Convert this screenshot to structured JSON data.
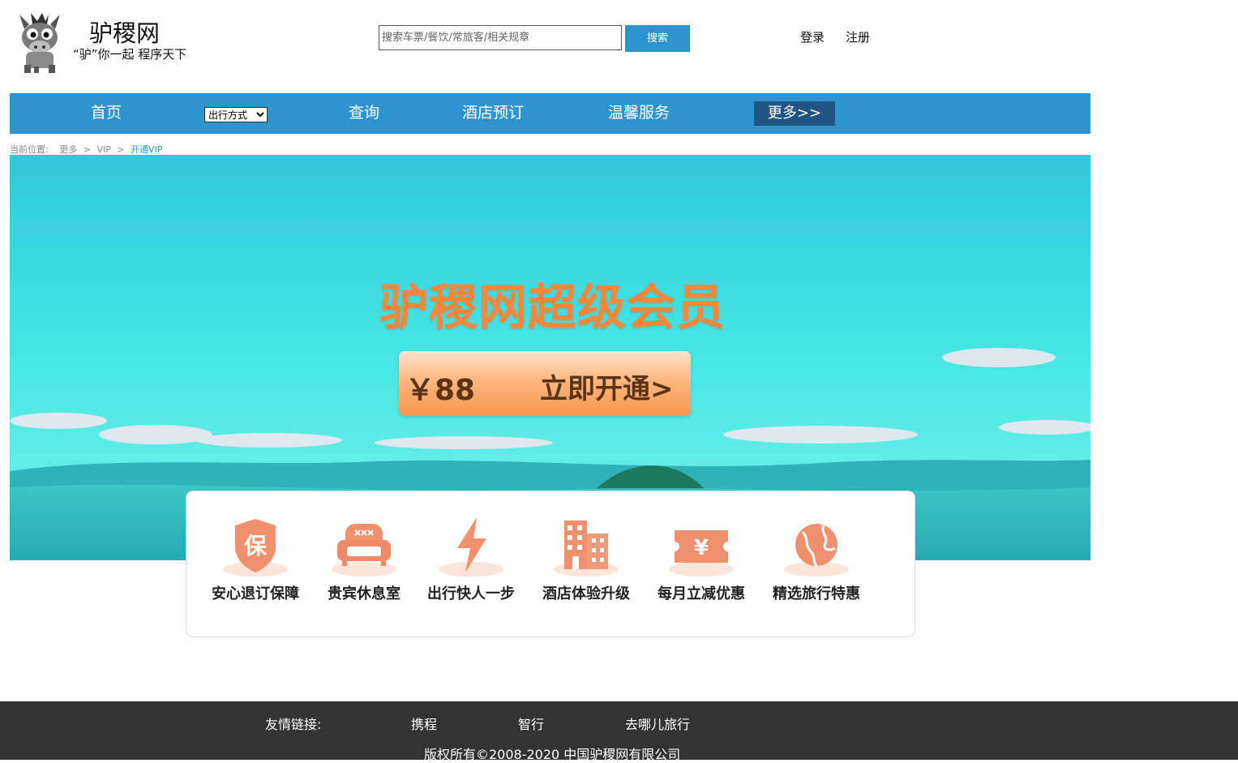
{
  "header": {
    "site_name": "驴稷网",
    "slogan": "“驴”你一起 程序天下",
    "search_placeholder": "搜索车票/餐饮/常旅客/相关规章",
    "search_button": "搜索",
    "login": "登录",
    "register": "注册"
  },
  "nav": {
    "items": [
      "首页",
      "查询",
      "酒店预订",
      "温馨服务"
    ],
    "select_value": "出行方式",
    "more": "更多>>"
  },
  "breadcrumb": {
    "label": "当前位置:",
    "path": [
      "更多",
      "VIP"
    ],
    "current": "开通VIP",
    "sep": ">"
  },
  "banner": {
    "title": "驴稷网超级会员",
    "price": "￥88",
    "cta": "立即开通>"
  },
  "benefits": [
    {
      "label": "安心退订保障",
      "icon": "shield-icon",
      "icon_text": "保"
    },
    {
      "label": "贵宾休息室",
      "icon": "sofa-icon"
    },
    {
      "label": "出行快人一步",
      "icon": "lightning-icon"
    },
    {
      "label": "酒店体验升级",
      "icon": "building-icon"
    },
    {
      "label": "每月立减优惠",
      "icon": "coupon-icon",
      "icon_text": "¥"
    },
    {
      "label": "精选旅行特惠",
      "icon": "globe-icon"
    }
  ],
  "footer": {
    "links_label": "友情链接:",
    "links": [
      "携程",
      "智行",
      "去哪儿旅行"
    ],
    "copyright": "版权所有©2008-2020 中国驴稷网有限公司"
  },
  "colors": {
    "primary": "#2e94d0",
    "nav_more_bg": "#1f5580",
    "accent_orange": "#f4873a",
    "footer_bg": "#333333"
  }
}
